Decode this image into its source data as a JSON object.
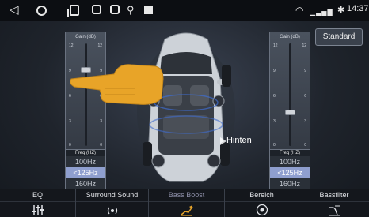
{
  "status_bar": {
    "icons": [
      "back-icon",
      "home-icon",
      "recent-apps-icon",
      "screenshot-icon",
      "screenshot-icon",
      "usb-icon",
      "image-icon",
      "wifi-icon",
      "signal-icon",
      "bluetooth-icon"
    ],
    "time": "14:37"
  },
  "left_gain": {
    "title": "Gain (dB)",
    "ticks": [
      "12",
      "9",
      "6",
      "3",
      "0"
    ],
    "level_db": 9
  },
  "right_gain": {
    "title": "Gain (dB)",
    "ticks": [
      "12",
      "9",
      "6",
      "3",
      "0"
    ],
    "level_db": 4
  },
  "left_freq": {
    "title": "Freq (HZ)",
    "options": [
      "100Hz",
      "<125Hz",
      "160Hz"
    ],
    "selected_index": 1
  },
  "right_freq": {
    "title": "Freq (HZ)",
    "options": [
      "100Hz",
      "<125Hz",
      "160Hz"
    ],
    "selected_index": 1
  },
  "preset_button": "Standard",
  "speaker_zone_label": "Hinten",
  "tabs": [
    {
      "label": "EQ",
      "icon": "equalizer-icon"
    },
    {
      "label": "Surround Sound",
      "icon": "surround-icon"
    },
    {
      "label": "Bass Boost",
      "icon": "bass-boost-icon",
      "active": true
    },
    {
      "label": "Bereich",
      "icon": "zone-target-icon"
    },
    {
      "label": "Bassfilter",
      "icon": "bass-filter-icon"
    }
  ],
  "colors": {
    "selected_freq": "#8f9fcf",
    "active_tab_label": "#8d8fa8",
    "active_tab_icon": "#e6a32a"
  }
}
